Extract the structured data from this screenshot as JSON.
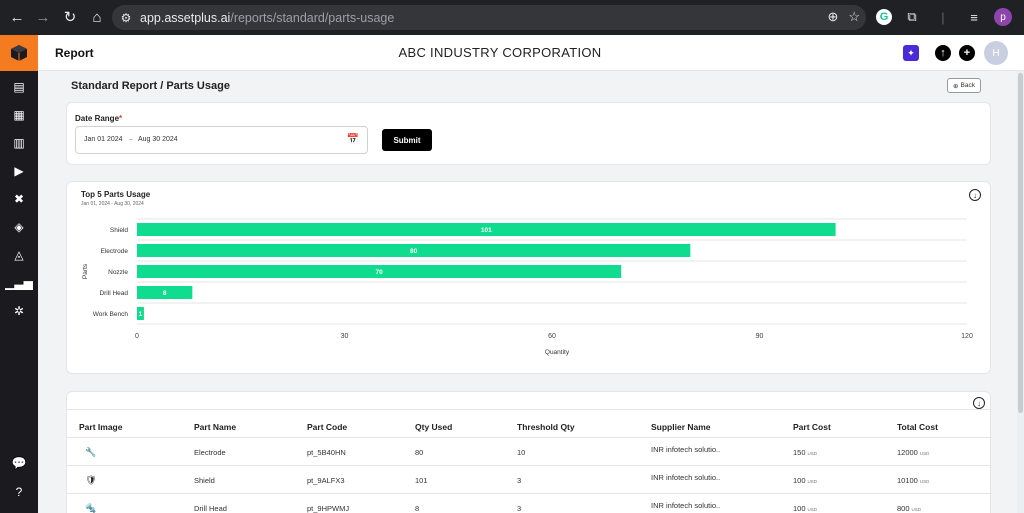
{
  "browser": {
    "url_host": "app.assetplus.ai",
    "url_path": "/reports/standard/parts-usage",
    "profile_initial": "p"
  },
  "header": {
    "title": "Report",
    "company": "ABC INDUSTRY CORPORATION",
    "avatar_initial": "H"
  },
  "breadcrumb": "Standard Report / Parts Usage",
  "back_label": "Back",
  "filter": {
    "label": "Date Range",
    "required_mark": "*",
    "start": "Jan 01 2024",
    "separator": "–",
    "end": "Aug 30 2024",
    "submit_label": "Submit"
  },
  "chart_card": {
    "title": "Top 5 Parts Usage",
    "subtitle": "Jan 01, 2024 - Aug 30, 2024"
  },
  "chart_data": {
    "type": "bar",
    "orientation": "horizontal",
    "categories": [
      "Shield",
      "Electrode",
      "Nozzle",
      "Drill Head",
      "Work Bench"
    ],
    "values": [
      101,
      80,
      70,
      8,
      1
    ],
    "xlabel": "Quantity",
    "ylabel": "Parts",
    "xlim": [
      0,
      120
    ],
    "xticks": [
      0,
      30,
      60,
      90,
      120
    ],
    "color": "#0fdc8e",
    "grid": true
  },
  "table": {
    "headers": [
      "Part Image",
      "Part Name",
      "Part Code",
      "Qty Used",
      "Threshold Qty",
      "Supplier Name",
      "Part Cost",
      "Total Cost"
    ],
    "currency": "USD",
    "rows": [
      {
        "name": "Electrode",
        "code": "pt_5B40HN",
        "qty": "80",
        "threshold": "10",
        "supplier": "INR infotech solutio..",
        "cost": "150",
        "total": "12000"
      },
      {
        "name": "Shield",
        "code": "pt_9ALFX3",
        "qty": "101",
        "threshold": "3",
        "supplier": "INR infotech solutio..",
        "cost": "100",
        "total": "10100"
      },
      {
        "name": "Drill Head",
        "code": "pt_9HPWMJ",
        "qty": "8",
        "threshold": "3",
        "supplier": "INR infotech solutio..",
        "cost": "100",
        "total": "800"
      }
    ]
  }
}
